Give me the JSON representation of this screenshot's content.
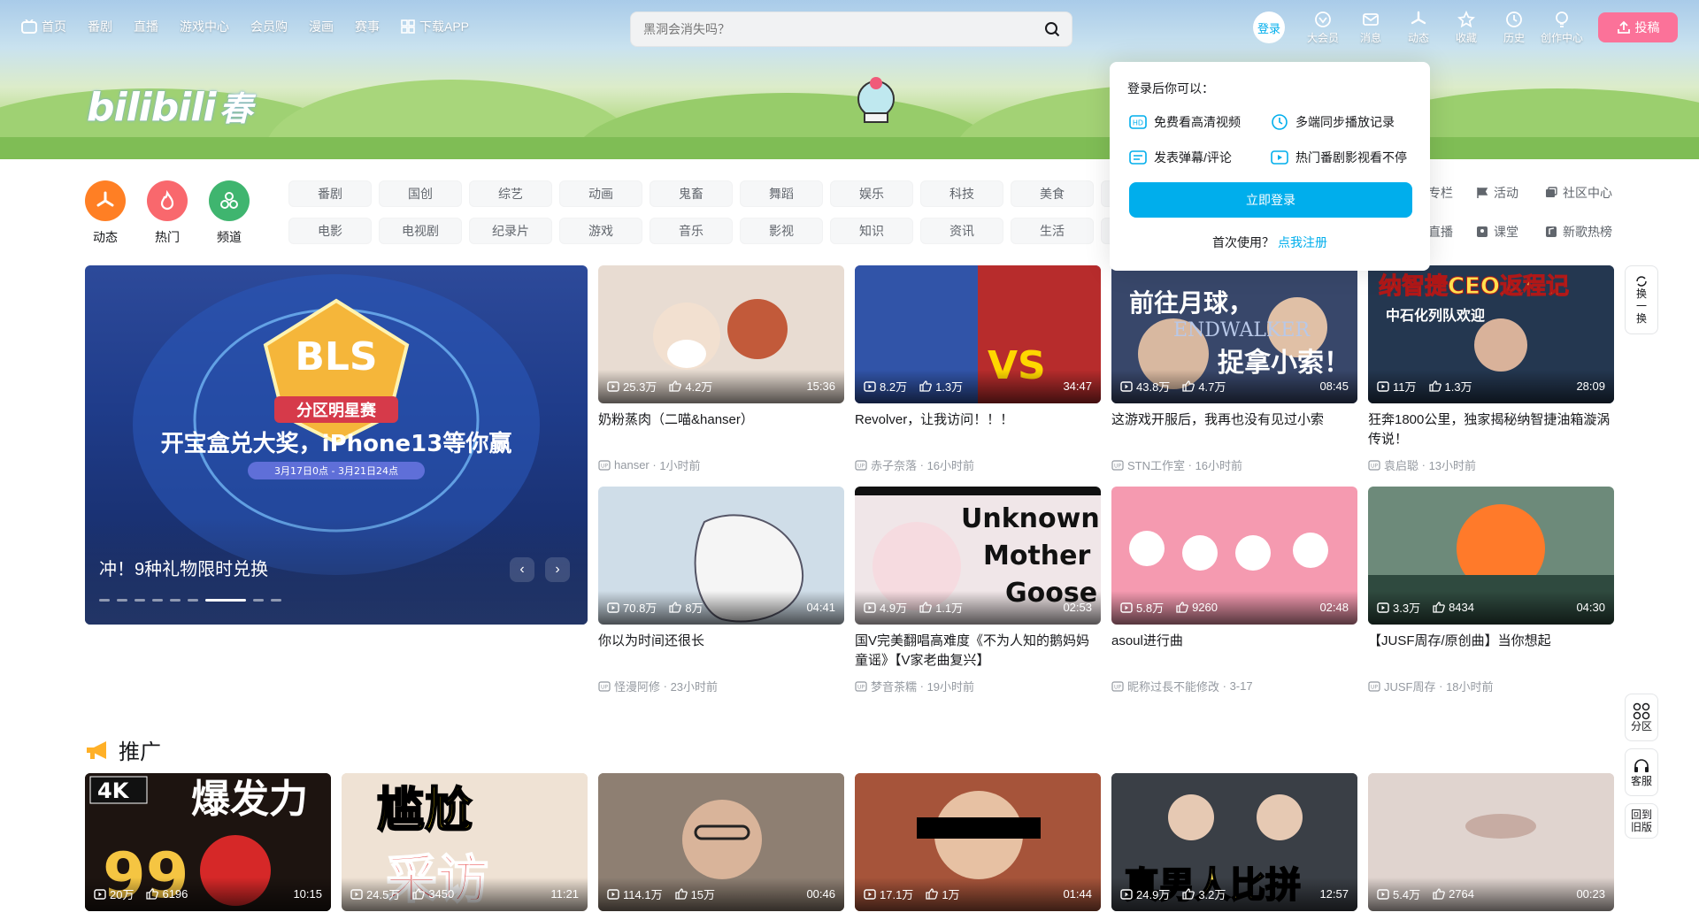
{
  "nav": {
    "home": "首页",
    "items": [
      "番剧",
      "直播",
      "游戏中心",
      "会员购",
      "漫画",
      "赛事"
    ],
    "download": "下载APP"
  },
  "search": {
    "placeholder": "黑洞会消失吗？"
  },
  "user": {
    "login": "登录",
    "items": [
      "大会员",
      "消息",
      "动态",
      "收藏",
      "历史",
      "创作中心"
    ],
    "upload": "投稿"
  },
  "logo": {
    "text": "bilibili",
    "sub": "春"
  },
  "channels": {
    "icons": [
      {
        "label": "动态",
        "color": "#ff7f24"
      },
      {
        "label": "热门",
        "color": "#f9686d"
      },
      {
        "label": "频道",
        "color": "#3fb56f"
      }
    ],
    "row1": [
      "番剧",
      "国创",
      "综艺",
      "动画",
      "鬼畜",
      "舞蹈",
      "娱乐",
      "科技",
      "美食"
    ],
    "row2": [
      "电影",
      "电视剧",
      "纪录片",
      "游戏",
      "音乐",
      "影视",
      "知识",
      "资讯",
      "生活"
    ],
    "side_row1": [
      "专栏",
      "活动",
      "社区中心"
    ],
    "side_row2": [
      "直播",
      "课堂",
      "新歌热榜"
    ]
  },
  "popup": {
    "header": "登录后你可以：",
    "items": [
      "免费看高清视频",
      "多端同步播放记录",
      "发表弹幕/评论",
      "热门番剧影视看不停"
    ],
    "login_btn": "立即登录",
    "first_use": "首次使用？",
    "register": "点我注册"
  },
  "carousel": {
    "banner_main": "分区明星赛",
    "banner_sub": "开宝盒兑大奖，iPhone13等你赢",
    "banner_logo": "BLS",
    "banner_date": "3月17日0点 - 3月21日24点",
    "title": "冲！9种礼物限时兑换",
    "active_dot": 6,
    "dot_count": 9
  },
  "videos": [
    {
      "views": "25.3万",
      "likes": "4.2万",
      "duration": "15:36",
      "title": "奶粉蒸肉（二喵&hanser）",
      "author": "hanser",
      "time": "1小时前",
      "bg": "#e8dcd2"
    },
    {
      "views": "8.2万",
      "likes": "1.3万",
      "duration": "34:47",
      "title": "Revolver，让我访问！！！",
      "author": "赤子奈落",
      "time": "16小时前",
      "bg": "#6a3b8f"
    },
    {
      "views": "43.8万",
      "likes": "4.7万",
      "duration": "08:45",
      "title": "这游戏开服后，我再也没有见过小索",
      "author": "STN工作室",
      "time": "16小时前",
      "bg": "#3b4d6e"
    },
    {
      "views": "11万",
      "likes": "1.3万",
      "duration": "28:09",
      "title": "狂奔1800公里，独家揭秘纳智捷油箱漩涡传说！",
      "author": "袁启聪",
      "time": "13小时前",
      "bg": "#2a3e5c"
    },
    {
      "views": "70.8万",
      "likes": "8万",
      "duration": "04:41",
      "title": "你以为时间还很长",
      "author": "怪漫阿修",
      "time": "23小时前",
      "bg": "#cfdde8"
    },
    {
      "views": "4.9万",
      "likes": "1.1万",
      "duration": "02:53",
      "title": "国V完美翻唱高难度《不为人知的鹅妈妈童谣》【V家老曲复兴】",
      "author": "梦音茶糯",
      "time": "19小时前",
      "bg": "#f0e6e8"
    },
    {
      "views": "5.8万",
      "likes": "9260",
      "duration": "02:48",
      "title": "asoul进行曲",
      "author": "昵称过長不能修改",
      "time": "3-17",
      "bg": "#f59ab0"
    },
    {
      "views": "3.3万",
      "likes": "8434",
      "duration": "04:30",
      "title": "【JUSF周存/原创曲】当你想起",
      "author": "JUSF周存",
      "time": "18小时前",
      "bg": "#6d8a7a"
    }
  ],
  "thumb_text": {
    "v1": "前往月球，",
    "v1b": "捉拿小索！",
    "v1c": "ENDWALKER",
    "v2": "纳智捷CEO返程记",
    "v2b": "中石化列队欢迎",
    "v3a": "Unknown",
    "v3b": "Mother",
    "v3c": "Goose"
  },
  "promo": {
    "title": "推广",
    "cards": [
      {
        "views": "20万",
        "likes": "6196",
        "duration": "10:15",
        "bg": "#2b1d14",
        "text": "爆发力",
        "text2": "4K",
        "text3": "99"
      },
      {
        "views": "24.5万",
        "likes": "3450",
        "duration": "11:21",
        "bg": "#e9d7c3",
        "text": "尴尬",
        "text2": "采访",
        "text3": ""
      },
      {
        "views": "114.1万",
        "likes": "15万",
        "duration": "00:46",
        "bg": "#8a7a6c",
        "text": "",
        "text2": "",
        "text3": ""
      },
      {
        "views": "17.1万",
        "likes": "1万",
        "duration": "01:44",
        "bg": "#a6543a",
        "text": "",
        "text2": "",
        "text3": ""
      },
      {
        "views": "24.9万",
        "likes": "3.2万",
        "duration": "12:57",
        "bg": "#3a3f46",
        "text": "真男人比拼",
        "text2": "",
        "text3": ""
      },
      {
        "views": "5.4万",
        "likes": "2764",
        "duration": "00:23",
        "bg": "#d8c9c2",
        "text": "",
        "text2": "",
        "text3": ""
      }
    ]
  },
  "right_tools": {
    "refresh": "换一换",
    "zone": "分区",
    "service": "客服",
    "old": "回到旧版"
  }
}
